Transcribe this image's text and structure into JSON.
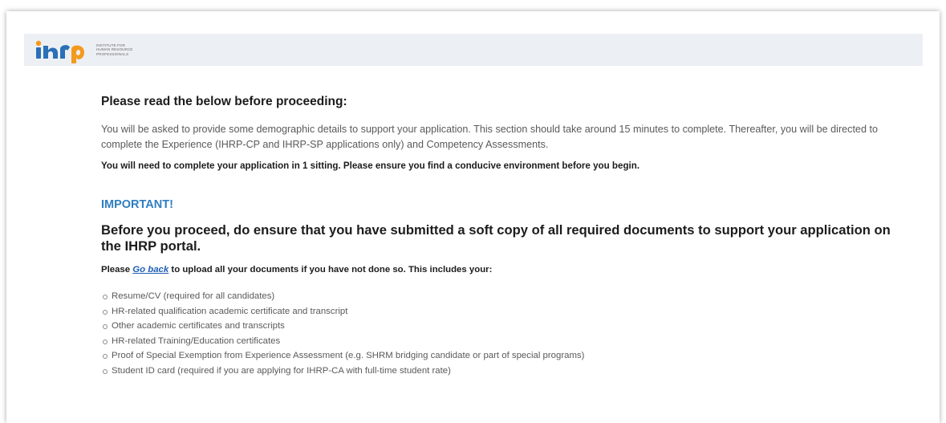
{
  "header": {
    "logo_text_lines": [
      "INSTITUTE FOR",
      "HUMAN RESOURCE",
      "PROFESSIONALS"
    ],
    "brand_colors": {
      "blue": "#2a6fb7",
      "orange": "#f39a1e"
    }
  },
  "main": {
    "title": "Please read the below before proceeding:",
    "intro": "You will be asked to provide some demographic details to support your application. This section should take around 15 minutes to complete. Thereafter, you will be directed to complete the Experience (IHRP-CP and IHRP-SP applications only) and Competency Assessments.",
    "sitting_note": "You will need to complete your application in 1 sitting. Please ensure you find a conducive environment before you begin.",
    "important_label": "IMPORTANT!",
    "proceed_heading": "Before you proceed, do ensure that you have submitted a soft copy of all required documents to support your application on the IHRP portal.",
    "goback_prefix": "Please ",
    "goback_link": "Go back",
    "goback_suffix": " to upload all your documents if you have not done so. This includes your:",
    "documents": [
      "Resume/CV (required for all candidates)",
      "HR-related qualification academic certificate and transcript",
      "Other academic certificates and transcripts",
      "HR-related Training/Education certificates",
      "Proof of Special Exemption from Experience Assessment (e.g. SHRM bridging candidate or part of special programs)",
      "Student ID card (required if you are applying for IHRP-CA with full-time student rate)"
    ]
  }
}
